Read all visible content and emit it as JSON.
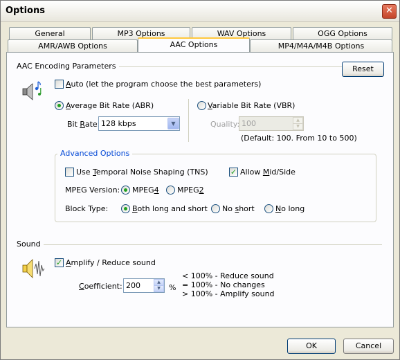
{
  "window": {
    "title": "Options",
    "close_glyph": "✕"
  },
  "tabs_row1": [
    "General",
    "MP3 Options",
    "WAV Options",
    "OGG Options"
  ],
  "tabs_row2": [
    "AMR/AWB Options",
    "AAC Options",
    "MP4/M4A/M4B Options"
  ],
  "active_tab": "AAC Options",
  "aac": {
    "section_title": "AAC Encoding Parameters",
    "reset_label": "Reset",
    "auto_mnemonic": "A",
    "auto_rest": "uto (let the program choose the best parameters)",
    "auto_checked": false,
    "abr_mnemonic": "A",
    "abr_rest": "verage Bit Rate (ABR)",
    "abr_selected": true,
    "vbr_mnemonic": "V",
    "vbr_rest": "ariable Bit Rate (VBR)",
    "vbr_selected": false,
    "bitrate_pre": "Bit ",
    "bitrate_mnemonic": "R",
    "bitrate_post": "ate:",
    "bitrate_value": "128 kbps",
    "quality_label": "Quality:",
    "quality_value": "100",
    "quality_hint": "(Default: 100. From 10 to 500)"
  },
  "advanced": {
    "title": "Advanced Options",
    "tns_pre": "Use ",
    "tns_mnemonic": "T",
    "tns_post": "emporal Noise Shaping (TNS)",
    "tns_checked": false,
    "midside_pre": "Allow ",
    "midside_mnemonic": "M",
    "midside_post": "id/Side",
    "midside_checked": true,
    "mpeg_label": "MPEG Version:",
    "mpeg4_pre": "MPEG",
    "mpeg4_mnemonic": "4",
    "mpeg2_pre": "MPEG",
    "mpeg2_mnemonic": "2",
    "mpeg_selected": "MPEG4",
    "block_label": "Block Type:",
    "block_both_mnemonic": "B",
    "block_both_rest": "oth long and short",
    "block_noshort_pre": "No ",
    "block_noshort_mnemonic": "s",
    "block_noshort_post": "hort",
    "block_nolong_mnemonic": "N",
    "block_nolong_rest": "o long",
    "block_selected": "Both long and short"
  },
  "sound": {
    "section_title": "Sound",
    "amplify_mnemonic": "A",
    "amplify_rest": "mplify / Reduce sound",
    "amplify_checked": true,
    "coef_mnemonic": "C",
    "coef_rest": "oefficient:",
    "coef_value": "200",
    "coef_unit": "%",
    "hint_lines": [
      "< 100% - Reduce sound",
      "= 100% - No changes",
      "> 100% - Amplify sound"
    ]
  },
  "footer": {
    "ok_label": "OK",
    "cancel_label": "Cancel"
  },
  "icons": {
    "aac-music-icon": "speaker with music notes",
    "speaker-wave-icon": "speaker with sound wave",
    "close-icon": "close",
    "dropdown-arrow-icon": "chevron down",
    "spin-up-icon": "arrow up",
    "spin-down-icon": "arrow down"
  },
  "colors": {
    "check_green": "#21a121",
    "tab_highlight": "#ffc83c",
    "group_title": "#0046d5",
    "window_bg": "#ece9d8"
  }
}
